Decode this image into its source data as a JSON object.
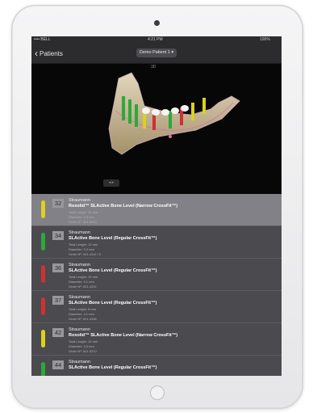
{
  "status_bar": {
    "carrier": "•••• BELL",
    "time": "4:21 PM",
    "battery": "100%"
  },
  "nav": {
    "back_label": "Patients",
    "patient_selector": "Demo Patient 1 ▾"
  },
  "viewer": {
    "page_label": "3D",
    "control_label": "◂ ▸"
  },
  "implants": [
    {
      "number": "32",
      "brand": "Straumann",
      "product": "Roxolid™ SLActive Bone Level (Narrow CrossFit™)",
      "color": "#d9d21e",
      "selected": true,
      "details": [
        "Total Length: 10 mm",
        "Diameter: 3.3 mm",
        "Order Nº: 021.5210"
      ]
    },
    {
      "number": "34",
      "brand": "Straumann",
      "product": "SLActive Bone Level (Regular CrossFit™)",
      "color": "#2ea83a",
      "selected": false,
      "details": [
        "Total Length: 12 mm",
        "Diameter: 3.3 mm",
        "Order Nº: 021.4112 / 0"
      ]
    },
    {
      "number": "36",
      "brand": "Straumann",
      "product": "SLActive Bone Level (Regular CrossFit™)",
      "color": "#cc3232",
      "selected": false,
      "details": [
        "Total Length: 10 mm",
        "Diameter: 4.1 mm",
        "Order Nº: 021.4110"
      ]
    },
    {
      "number": "37",
      "brand": "Straumann",
      "product": "SLActive Bone Level (Regular CrossFit™)",
      "color": "#cc3232",
      "selected": false,
      "details": [
        "Total Length: 8 mm",
        "Diameter: 4.1 mm",
        "Order Nº: 021.4108"
      ]
    },
    {
      "number": "42",
      "brand": "Straumann",
      "product": "Roxolid™ SLActive Bone Level (Narrow CrossFit™)",
      "color": "#d9d21e",
      "selected": false,
      "details": [
        "Total Length: 10 mm",
        "Diameter: 3.3 mm",
        "Order Nº: 021.5210"
      ]
    },
    {
      "number": "44",
      "brand": "Straumann",
      "product": "SLActive Bone Level (Regular CrossFit™)",
      "color": "#2ea83a",
      "selected": false,
      "details": []
    }
  ]
}
